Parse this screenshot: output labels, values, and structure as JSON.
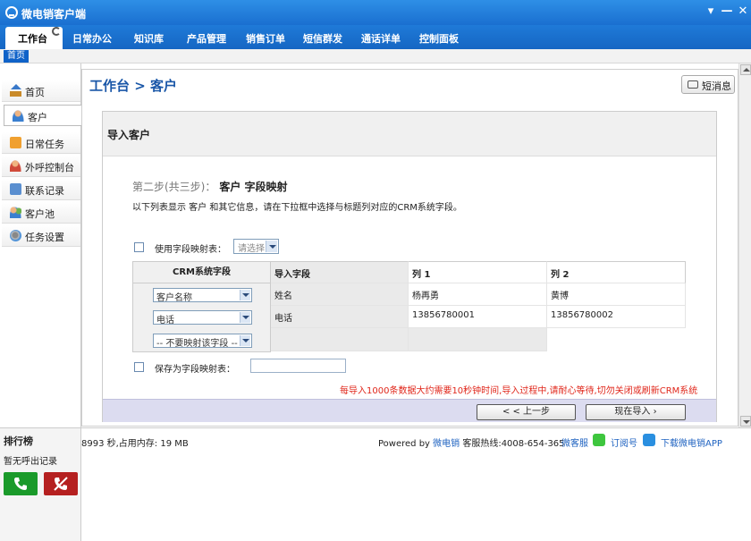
{
  "app": {
    "title": "微电销客户端"
  },
  "window_controls": {
    "menu": "▾",
    "minimize": "—",
    "close": "✕"
  },
  "menu": [
    {
      "label": "工作台",
      "active": true
    },
    {
      "label": "日常办公"
    },
    {
      "label": "知识库"
    },
    {
      "label": "产品管理"
    },
    {
      "label": "销售订单"
    },
    {
      "label": "短信群发"
    },
    {
      "label": "通话详单"
    },
    {
      "label": "控制面板"
    }
  ],
  "subtab": {
    "label": "首页"
  },
  "sidebar": {
    "items": [
      {
        "label": "首页",
        "icon": "home-icon"
      },
      {
        "label": "客户",
        "icon": "customer-icon",
        "active": true
      },
      {
        "label": "日常任务",
        "icon": "task-icon"
      },
      {
        "label": "外呼控制台",
        "icon": "outbound-icon"
      },
      {
        "label": "联系记录",
        "icon": "contact-record-icon"
      },
      {
        "label": "客户池",
        "icon": "customer-pool-icon"
      },
      {
        "label": "任务设置",
        "icon": "task-setting-icon"
      }
    ]
  },
  "breadcrumb": {
    "text": "工作台  > 客户"
  },
  "message_button": {
    "label": "短消息"
  },
  "panel": {
    "title": "导入客户",
    "step_prefix": "第二步(共三步)：",
    "step_title": "客户  字段映射",
    "description": "以下列表显示 客户 和其它信息，请在下拉框中选择与标题列对应的CRM系统字段。",
    "use_mapping_label": "使用字段映射表：",
    "use_mapping_select": "请选择",
    "table": {
      "crm_header": "CRM系统字段",
      "headers": [
        "导入字段",
        "列 1",
        "列 2"
      ],
      "rows": [
        {
          "crm": "客户名称",
          "field": "姓名",
          "col1": "杨再勇",
          "col2": "黄博"
        },
        {
          "crm": "电话",
          "field": "电话",
          "col1": "13856780001",
          "col2": "13856780002"
        },
        {
          "crm": "-- 不要映射该字段 --",
          "field": "",
          "col1": "",
          "col2": ""
        }
      ]
    },
    "save_mapping_label": "保存为字段映射表：",
    "save_mapping_value": "",
    "warning": "每导入1000条数据大约需要10秒钟时间,导入过程中,请耐心等待,切勿关闭或刷新CRM系统",
    "prev_button": "< < 上一步",
    "import_button": "现在导入 ›"
  },
  "status": {
    "memory": "8993 秒,占用内存: 19 MB",
    "powered_prefix": "Powered by ",
    "powered_brand": "微电销",
    "hotline": "  客服热线:4008-654-365",
    "service_link": "微客服",
    "subscribe_link": "订阅号",
    "download_link": "下载微电销APP"
  },
  "ranking": {
    "title": "排行榜",
    "subtitle": "暂无呼出记录"
  },
  "colors": {
    "accent": "#1a6fd0",
    "warning": "#e0261a",
    "call_green": "#1a9a2a",
    "call_red": "#b52020"
  }
}
